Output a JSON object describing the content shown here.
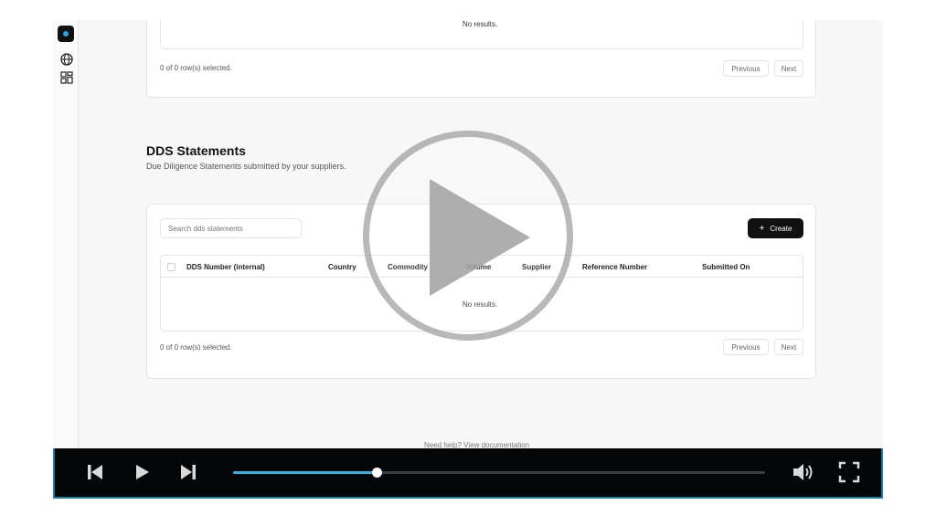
{
  "sidebar": {
    "logo_icon": "logo-icon",
    "items": [
      {
        "icon": "globe-icon"
      },
      {
        "icon": "grid-icon"
      }
    ]
  },
  "top_table": {
    "no_results": "No results.",
    "selection_text": "0 of 0 row(s) selected.",
    "previous_label": "Previous",
    "next_label": "Next"
  },
  "dds": {
    "title": "DDS Statements",
    "subtitle": "Due Diligence Statements submitted by your suppliers.",
    "search_placeholder": "Search dds statements",
    "create_label": "Create",
    "create_icon": "plus-icon",
    "columns": [
      "DDS Number (internal)",
      "Country",
      "Commodity",
      "Volume",
      "Supplier",
      "Reference Number",
      "Submitted On"
    ],
    "no_results": "No results.",
    "selection_text": "0 of 0 row(s) selected.",
    "previous_label": "Previous",
    "next_label": "Next"
  },
  "footer": {
    "help_text": "Need help? View documentation"
  },
  "player": {
    "progress": 0.27,
    "accent_color": "#34b2e4",
    "icons": [
      "skip-back-icon",
      "play-icon",
      "skip-forward-icon",
      "volume-icon",
      "fullscreen-icon"
    ]
  }
}
